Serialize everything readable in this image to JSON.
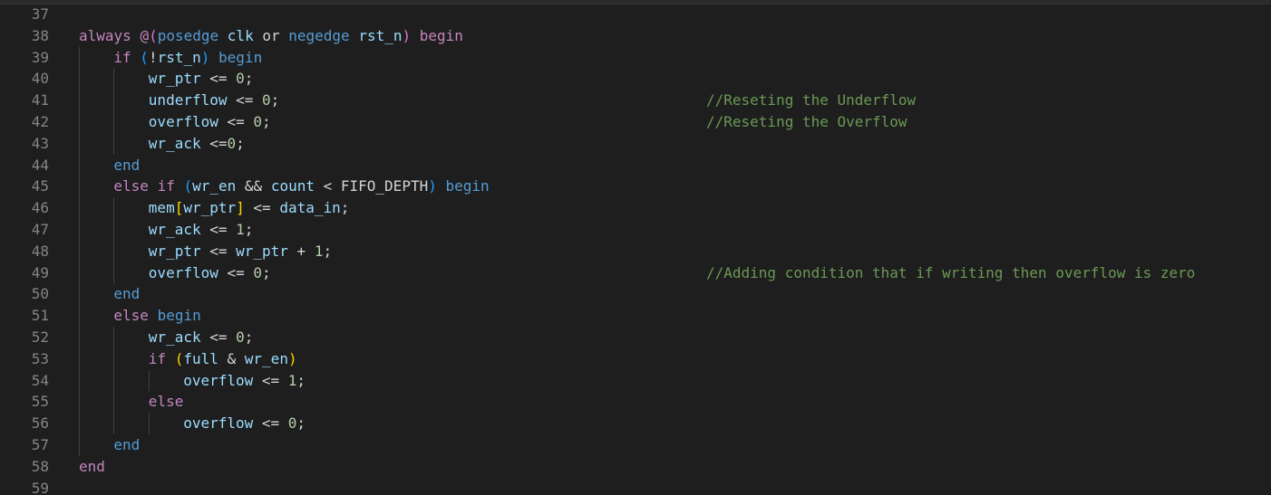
{
  "editor": {
    "line_numbers": [
      "37",
      "38",
      "39",
      "40",
      "41",
      "42",
      "43",
      "44",
      "45",
      "46",
      "47",
      "48",
      "49",
      "50",
      "51",
      "52",
      "53",
      "54",
      "55",
      "56",
      "57",
      "58",
      "59"
    ],
    "lines": [
      {
        "indent": 0,
        "tokens": []
      },
      {
        "indent": 0,
        "tokens": [
          {
            "t": "always",
            "c": "kw"
          },
          {
            "t": " ",
            "c": "op"
          },
          {
            "t": "@",
            "c": "kw"
          },
          {
            "t": "(",
            "c": "b2"
          },
          {
            "t": "posedge",
            "c": "kb"
          },
          {
            "t": " ",
            "c": "op"
          },
          {
            "t": "clk",
            "c": "id"
          },
          {
            "t": " or ",
            "c": "op"
          },
          {
            "t": "negedge",
            "c": "kb"
          },
          {
            "t": " ",
            "c": "op"
          },
          {
            "t": "rst_n",
            "c": "id"
          },
          {
            "t": ")",
            "c": "b2"
          },
          {
            "t": " ",
            "c": "op"
          },
          {
            "t": "begin",
            "c": "kw"
          }
        ]
      },
      {
        "indent": 1,
        "tokens": [
          {
            "t": "if",
            "c": "kw"
          },
          {
            "t": " ",
            "c": "op"
          },
          {
            "t": "(",
            "c": "b3"
          },
          {
            "t": "!",
            "c": "op"
          },
          {
            "t": "rst_n",
            "c": "id"
          },
          {
            "t": ")",
            "c": "b3"
          },
          {
            "t": " ",
            "c": "op"
          },
          {
            "t": "begin",
            "c": "kb"
          }
        ]
      },
      {
        "indent": 2,
        "tokens": [
          {
            "t": "wr_ptr",
            "c": "id"
          },
          {
            "t": " <= ",
            "c": "op"
          },
          {
            "t": "0",
            "c": "num"
          },
          {
            "t": ";",
            "c": "op"
          }
        ]
      },
      {
        "indent": 2,
        "tokens": [
          {
            "t": "underflow",
            "c": "id"
          },
          {
            "t": " <= ",
            "c": "op"
          },
          {
            "t": "0",
            "c": "num"
          },
          {
            "t": ";",
            "c": "op"
          }
        ],
        "comment": "//Reseting the Underflow"
      },
      {
        "indent": 2,
        "tokens": [
          {
            "t": "overflow",
            "c": "id"
          },
          {
            "t": " <= ",
            "c": "op"
          },
          {
            "t": "0",
            "c": "num"
          },
          {
            "t": ";",
            "c": "op"
          }
        ],
        "comment": "//Reseting the Overflow"
      },
      {
        "indent": 2,
        "tokens": [
          {
            "t": "wr_ack",
            "c": "id"
          },
          {
            "t": " <=",
            "c": "op"
          },
          {
            "t": "0",
            "c": "num"
          },
          {
            "t": ";",
            "c": "op"
          }
        ]
      },
      {
        "indent": 1,
        "tokens": [
          {
            "t": "end",
            "c": "kb"
          }
        ]
      },
      {
        "indent": 1,
        "tokens": [
          {
            "t": "else",
            "c": "kw"
          },
          {
            "t": " ",
            "c": "op"
          },
          {
            "t": "if",
            "c": "kw"
          },
          {
            "t": " ",
            "c": "op"
          },
          {
            "t": "(",
            "c": "b3"
          },
          {
            "t": "wr_en",
            "c": "id"
          },
          {
            "t": " && ",
            "c": "op"
          },
          {
            "t": "count",
            "c": "id"
          },
          {
            "t": " < FIFO_DEPTH",
            "c": "op"
          },
          {
            "t": ")",
            "c": "b3"
          },
          {
            "t": " ",
            "c": "op"
          },
          {
            "t": "begin",
            "c": "kb"
          }
        ]
      },
      {
        "indent": 2,
        "tokens": [
          {
            "t": "mem",
            "c": "id"
          },
          {
            "t": "[",
            "c": "b1"
          },
          {
            "t": "wr_ptr",
            "c": "id"
          },
          {
            "t": "]",
            "c": "b1"
          },
          {
            "t": " <= ",
            "c": "op"
          },
          {
            "t": "data_in",
            "c": "id"
          },
          {
            "t": ";",
            "c": "op"
          }
        ]
      },
      {
        "indent": 2,
        "tokens": [
          {
            "t": "wr_ack",
            "c": "id"
          },
          {
            "t": " <= ",
            "c": "op"
          },
          {
            "t": "1",
            "c": "num"
          },
          {
            "t": ";",
            "c": "op"
          }
        ]
      },
      {
        "indent": 2,
        "tokens": [
          {
            "t": "wr_ptr",
            "c": "id"
          },
          {
            "t": " <= ",
            "c": "op"
          },
          {
            "t": "wr_ptr",
            "c": "id"
          },
          {
            "t": " + ",
            "c": "op"
          },
          {
            "t": "1",
            "c": "num"
          },
          {
            "t": ";",
            "c": "op"
          }
        ]
      },
      {
        "indent": 2,
        "tokens": [
          {
            "t": "overflow",
            "c": "id"
          },
          {
            "t": " <= ",
            "c": "op"
          },
          {
            "t": "0",
            "c": "num"
          },
          {
            "t": ";",
            "c": "op"
          }
        ],
        "comment": "//Adding condition that if writing then overflow is zero"
      },
      {
        "indent": 1,
        "tokens": [
          {
            "t": "end",
            "c": "kb"
          }
        ]
      },
      {
        "indent": 1,
        "tokens": [
          {
            "t": "else",
            "c": "kw"
          },
          {
            "t": " ",
            "c": "op"
          },
          {
            "t": "begin",
            "c": "kb"
          }
        ]
      },
      {
        "indent": 2,
        "tokens": [
          {
            "t": "wr_ack",
            "c": "id"
          },
          {
            "t": " <= ",
            "c": "op"
          },
          {
            "t": "0",
            "c": "num"
          },
          {
            "t": ";",
            "c": "op"
          }
        ]
      },
      {
        "indent": 2,
        "tokens": [
          {
            "t": "if",
            "c": "kw"
          },
          {
            "t": " ",
            "c": "op"
          },
          {
            "t": "(",
            "c": "b1"
          },
          {
            "t": "full",
            "c": "id"
          },
          {
            "t": " & ",
            "c": "op"
          },
          {
            "t": "wr_en",
            "c": "id"
          },
          {
            "t": ")",
            "c": "b1"
          }
        ]
      },
      {
        "indent": 3,
        "tokens": [
          {
            "t": "overflow",
            "c": "id"
          },
          {
            "t": " <= ",
            "c": "op"
          },
          {
            "t": "1",
            "c": "num"
          },
          {
            "t": ";",
            "c": "op"
          }
        ]
      },
      {
        "indent": 2,
        "tokens": [
          {
            "t": "else",
            "c": "kw"
          }
        ]
      },
      {
        "indent": 3,
        "tokens": [
          {
            "t": "overflow",
            "c": "id"
          },
          {
            "t": " <= ",
            "c": "op"
          },
          {
            "t": "0",
            "c": "num"
          },
          {
            "t": ";",
            "c": "op"
          }
        ]
      },
      {
        "indent": 1,
        "tokens": [
          {
            "t": "end",
            "c": "kb"
          }
        ]
      },
      {
        "indent": 0,
        "tokens": [
          {
            "t": "end",
            "c": "kw"
          }
        ]
      },
      {
        "indent": 0,
        "tokens": []
      }
    ]
  }
}
